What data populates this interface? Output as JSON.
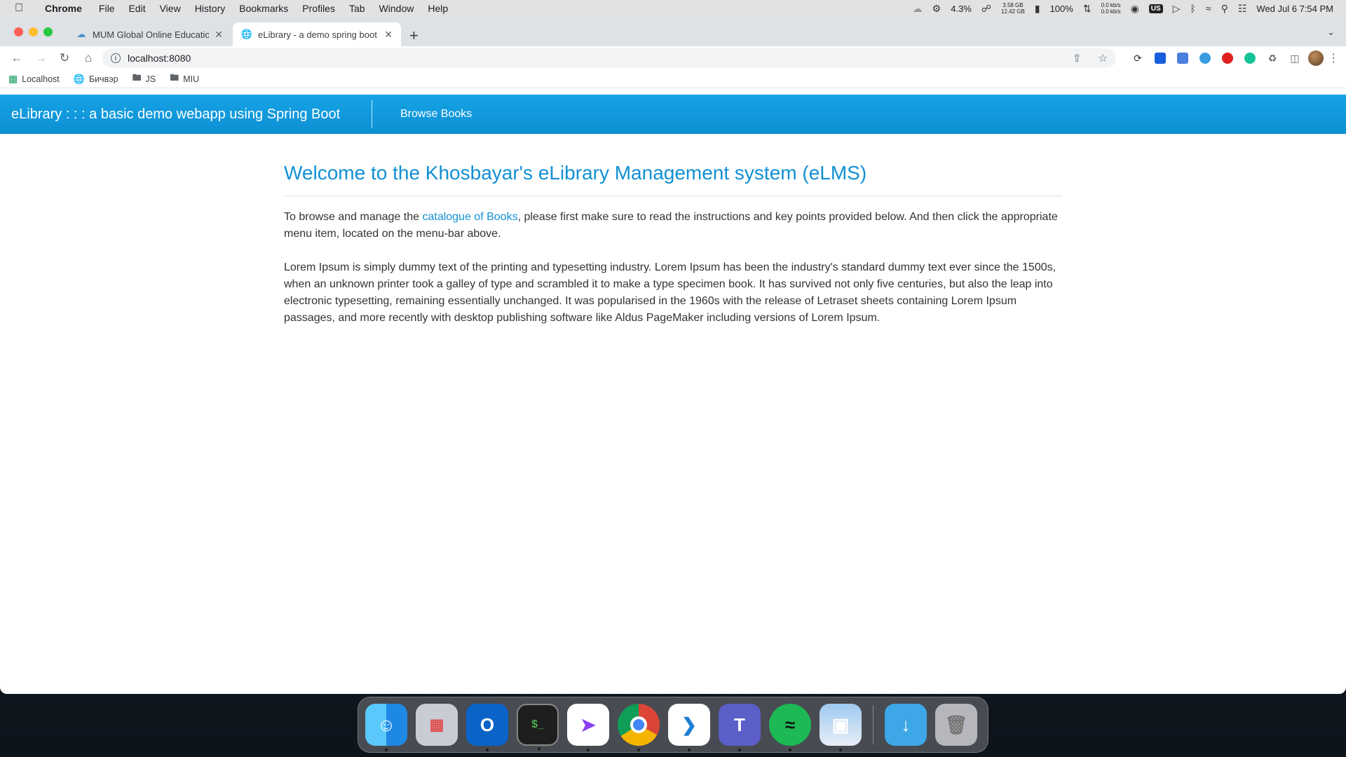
{
  "menubar": {
    "app": "Chrome",
    "items": [
      "File",
      "Edit",
      "View",
      "History",
      "Bookmarks",
      "Profiles",
      "Tab",
      "Window",
      "Help"
    ],
    "cpu": "4.3%",
    "mem_top": "3.58 GB",
    "mem_bottom": "12.42 GB",
    "battery": "100%",
    "net_up": "0.0 kb/s",
    "net_down": "0.0 kb/s",
    "input_source": "US",
    "datetime": "Wed Jul 6  7:54 PM"
  },
  "browser": {
    "tabs": [
      {
        "title": "MUM Global Online Education"
      },
      {
        "title": "eLibrary - a demo spring boot"
      }
    ],
    "url": "localhost:8080",
    "bookmarks": [
      "Localhost",
      "Бичвэр",
      "JS",
      "MIU"
    ]
  },
  "page": {
    "brand": "eLibrary : : : a basic demo webapp using Spring Boot",
    "nav_link": "Browse Books",
    "heading": "Welcome to the Khosbayar's eLibrary Management system (eLMS)",
    "intro_before": "To browse and manage the ",
    "intro_link": "catalogue of Books",
    "intro_after": ", please first make sure to read the instructions and key points provided below. And then click the appropriate menu item, located on the menu-bar above.",
    "lorem": "Lorem Ipsum is simply dummy text of the printing and typesetting industry. Lorem Ipsum has been the industry's standard dummy text ever since the 1500s, when an unknown printer took a galley of type and scrambled it to make a type specimen book. It has survived not only five centuries, but also the leap into electronic typesetting, remaining essentially unchanged. It was popularised in the 1960s with the release of Letraset sheets containing Lorem Ipsum passages, and more recently with desktop publishing software like Aldus PageMaker including versions of Lorem Ipsum."
  },
  "colors": {
    "navbar": "#0c8fd3",
    "accent": "#1290d4"
  },
  "dock": [
    "finder-icon",
    "launchpad-icon",
    "outlook-icon",
    "terminal-icon",
    "messenger-icon",
    "chrome-icon",
    "vscode-icon",
    "teams-icon",
    "spotify-icon",
    "preview-icon",
    "downloads-icon",
    "trash-icon"
  ]
}
